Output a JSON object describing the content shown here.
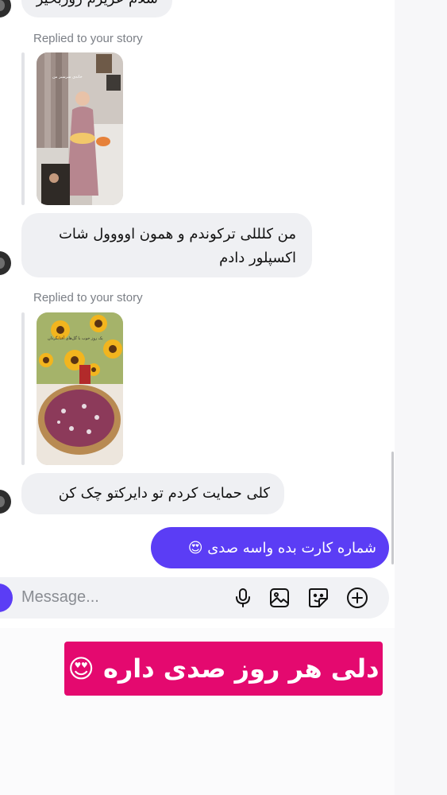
{
  "messages": {
    "top_partial": "سلام عزیزم روزبخیر",
    "reply_label_1": "Replied to your story",
    "msg_1": "من کلللی ترکوندم و همون اوووول شات اکسپلور دادم",
    "reply_label_2": "Replied to your story",
    "msg_2": "کلی حمایت کردم تو دایرکتو چک کن",
    "outgoing": "شماره کارت بده واسه صدی 😍"
  },
  "story_1_caption": "خانه‌ی سرسبز من",
  "story_2_caption": "یک روز خوب با گل‌های آفتابگردان",
  "composer": {
    "placeholder": "Message..."
  },
  "banner": {
    "text": "دلی هر روز صدی داره 😍"
  },
  "colors": {
    "outgoing_bubble": "#5b3df5",
    "incoming_bubble": "#eff0f3",
    "banner": "#e4096f"
  },
  "icons": [
    "microphone-icon",
    "gallery-icon",
    "sticker-icon",
    "add-icon",
    "camera-icon"
  ]
}
